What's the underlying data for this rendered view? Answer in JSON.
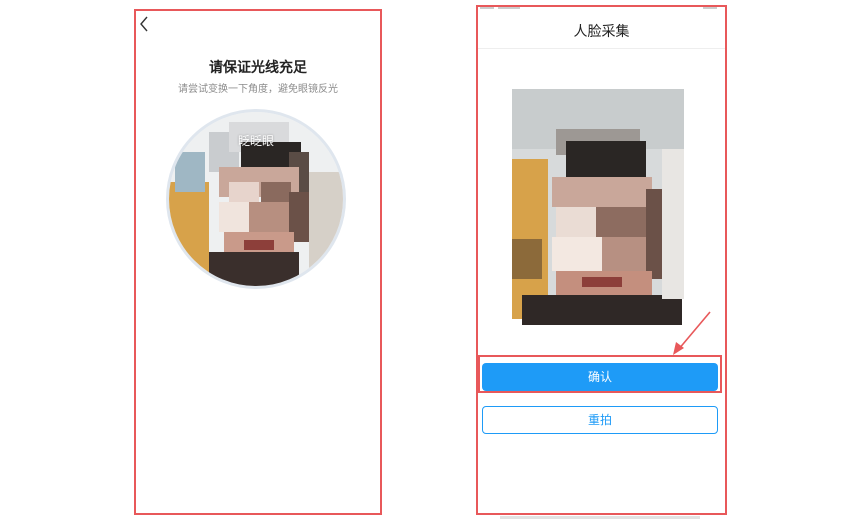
{
  "left_screen": {
    "title": "请保证光线充足",
    "subtitle": "请尝试变换一下角度，避免眼镜反光",
    "prompt_overlay": "眨眨眼",
    "icons": {
      "back": "chevron-left-icon"
    }
  },
  "right_screen": {
    "title": "人脸采集",
    "confirm_label": "确认",
    "retake_label": "重拍"
  },
  "colors": {
    "annotation_red": "#e8585a",
    "primary_blue": "#1e9bf7"
  }
}
